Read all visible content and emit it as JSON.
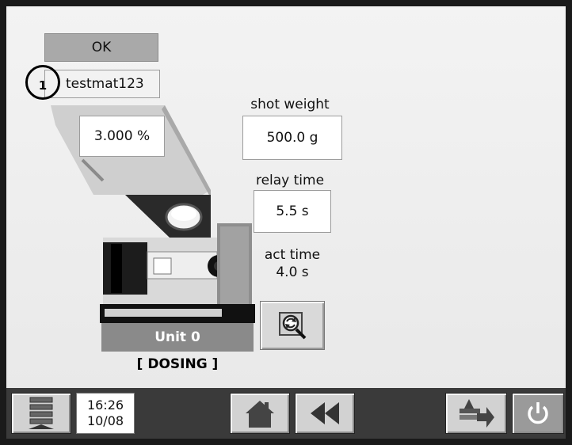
{
  "header": {
    "ok_label": "OK"
  },
  "material": {
    "name": "testmat123",
    "badge": "1",
    "percent": "3.000 %"
  },
  "shot_weight": {
    "label": "shot weight",
    "value": "500.0 g"
  },
  "relay_time": {
    "label": "relay time",
    "value": "5.5 s"
  },
  "act_time": {
    "label": "act time",
    "value": "4.0 s"
  },
  "unit": {
    "label": "Unit 0",
    "status": "[ DOSING ]"
  },
  "footer": {
    "time": "16:26",
    "date": "10/08"
  },
  "icons": {
    "menu": "menu-icon",
    "home": "home-icon",
    "back": "rewind-icon",
    "transfer": "transfer-icon",
    "power": "power-icon",
    "refresh": "refresh-magnifier-icon"
  }
}
